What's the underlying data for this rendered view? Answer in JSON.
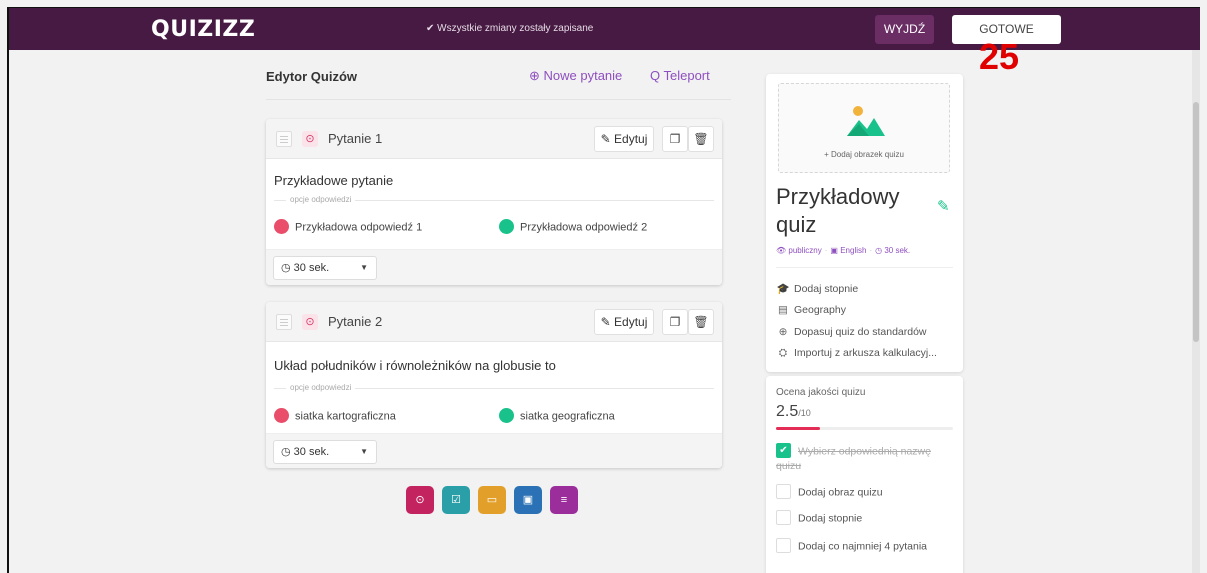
{
  "header": {
    "logo": "QUIZIZZ",
    "saved_status": "✔ Wszystkie zmiany zostały zapisane",
    "exit_label": "WYJDŹ",
    "done_label": "GOTOWE",
    "overlay_number": "25"
  },
  "editor": {
    "title": "Edytor Quizów",
    "new_question": "⊕ Nowe pytanie",
    "teleport": "Q Teleport"
  },
  "questions": [
    {
      "label": "Pytanie 1",
      "edit_label": "Edytuj",
      "text": "Przykładowe pytanie",
      "options_caption": "opcje odpowiedzi",
      "answers": [
        "Przykładowa odpowiedź 1",
        "Przykładowa odpowiedź 2"
      ],
      "time": "30 sek."
    },
    {
      "label": "Pytanie 2",
      "edit_label": "Edytuj",
      "text": "Układ południków i równoleżników na globusie to",
      "options_caption": "opcje odpowiedzi",
      "answers": [
        "siatka kartograficzna",
        "siatka geograficzna"
      ],
      "time": "30 sek."
    }
  ],
  "question_types": [
    {
      "icon": "multiple-choice-icon",
      "color": "#c3245f"
    },
    {
      "icon": "checkbox-icon",
      "color": "#2a9fa8"
    },
    {
      "icon": "fill-blank-icon",
      "color": "#e2a02b"
    },
    {
      "icon": "poll-icon",
      "color": "#2a72b5"
    },
    {
      "icon": "open-ended-icon",
      "color": "#9b2e9b"
    }
  ],
  "quiz": {
    "add_image": "+ Dodaj obrazek quizu",
    "title": "Przykładowy quiz",
    "visibility": "publiczny",
    "language": "English",
    "time": "30 sek.",
    "links": [
      "Dodaj stopnie",
      "Geography",
      "Dopasuj quiz do standardów",
      "Importuj z arkusza kalkulacyj..."
    ]
  },
  "quality": {
    "label": "Ocena jakości quizu",
    "score": "2.5",
    "score_max": "/10",
    "score_fraction": 0.25,
    "checklist": [
      {
        "text": "Wybierz odpowiednią nazwę quizu",
        "done": true
      },
      {
        "text": "Dodaj obraz quizu",
        "done": false
      },
      {
        "text": "Dodaj stopnie",
        "done": false
      },
      {
        "text": "Dodaj co najmniej 4 pytania",
        "done": false
      }
    ]
  },
  "colors": {
    "brand": "#461a42",
    "accent": "#8e4fbf",
    "correct": "#19c28a",
    "incorrect": "#ea4d6a",
    "score_bar": "#e32d56"
  }
}
